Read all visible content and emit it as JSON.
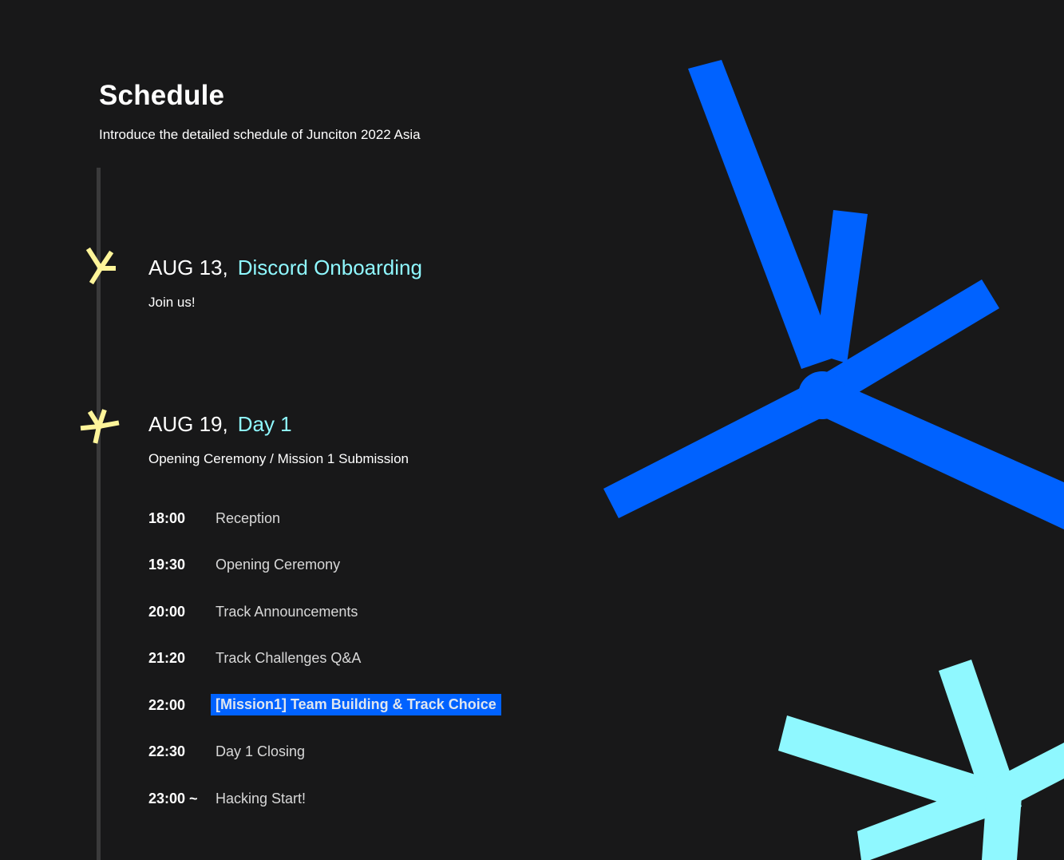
{
  "header": {
    "title": "Schedule",
    "subtitle": "Introduce the detailed schedule of Junciton 2022 Asia"
  },
  "events": [
    {
      "date": "AUG 13,",
      "name": "Discord Onboarding",
      "description": "Join us!"
    },
    {
      "date": "AUG 19,",
      "name": "Day 1",
      "description": "Opening Ceremony / Mission 1 Submission",
      "items": [
        {
          "time": "18:00",
          "label": "Reception"
        },
        {
          "time": "19:30",
          "label": "Opening Ceremony"
        },
        {
          "time": "20:00",
          "label": "Track Announcements"
        },
        {
          "time": "21:20",
          "label": "Track Challenges Q&A"
        },
        {
          "time": "22:00",
          "label": "[Mission1] Team Building & Track Choice",
          "highlight": true
        },
        {
          "time": "22:30",
          "label": "Day 1 Closing"
        },
        {
          "time": "23:00 ~",
          "label": "Hacking Start!"
        }
      ]
    }
  ],
  "colors": {
    "background": "#181819",
    "accent_blue": "#0062ff",
    "accent_cyan": "#8ff8ff",
    "marker_yellow": "#fff59a",
    "timeline": "#3a3a3b"
  },
  "icons": {
    "marker": "asterisk-marker-icon",
    "decoration_large": "blue-asterisk-decoration",
    "decoration_small": "cyan-asterisk-decoration"
  }
}
